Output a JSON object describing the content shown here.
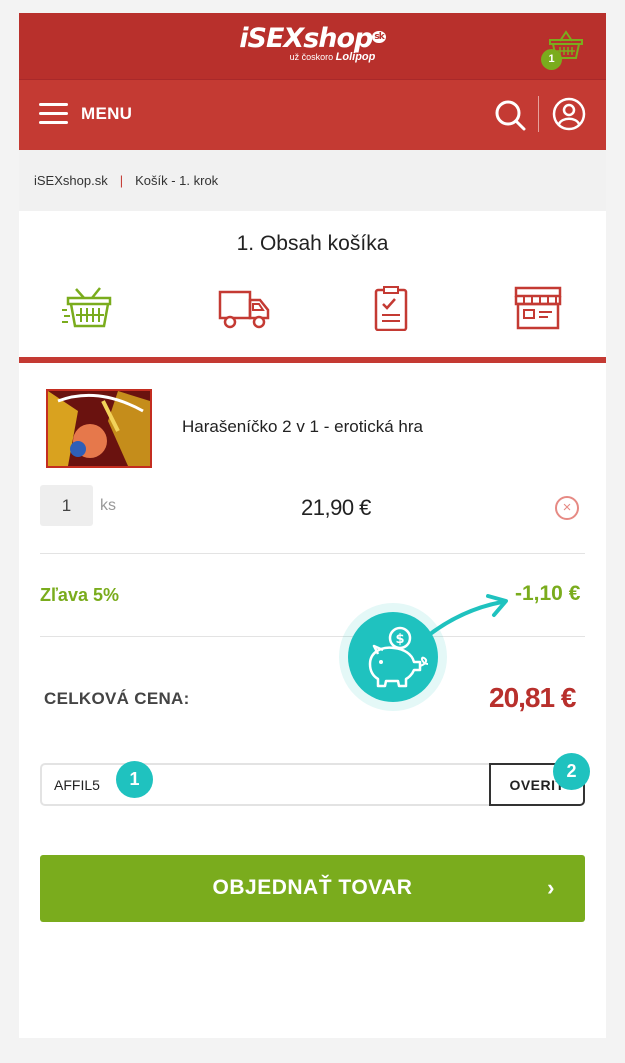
{
  "header": {
    "brand": "iSEXshop",
    "brand_suffix": "sk",
    "tagline_prefix": "už čoskoro",
    "tagline_brand": "Lolipop",
    "cart_count": "1"
  },
  "nav": {
    "menu_label": "MENU"
  },
  "breadcrumb": {
    "items": [
      "iSEXshop.sk",
      "Košík - 1. krok"
    ],
    "separator": "|"
  },
  "checkout": {
    "step_title": "1. Obsah košíka"
  },
  "cart_item": {
    "name": "Harašeníčko 2 v 1 - erotická hra",
    "quantity": "1",
    "unit": "ks",
    "price": "21,90 €",
    "remove_symbol": "×"
  },
  "discount": {
    "label": "Zľava 5%",
    "value": "-1,10 €"
  },
  "total": {
    "label": "CELKOVÁ CENA:",
    "value": "20,81 €"
  },
  "coupon": {
    "value": "AFFIL5",
    "button_label": "OVERIŤ"
  },
  "order": {
    "button_label": "OBJEDNAŤ TOVAR",
    "arrow": "›"
  },
  "annotations": {
    "badge_1": "1",
    "badge_2": "2"
  },
  "colors": {
    "brand_red": "#c43a33",
    "accent_green": "#7aac1d",
    "annotation_teal": "#1fc2bf"
  }
}
